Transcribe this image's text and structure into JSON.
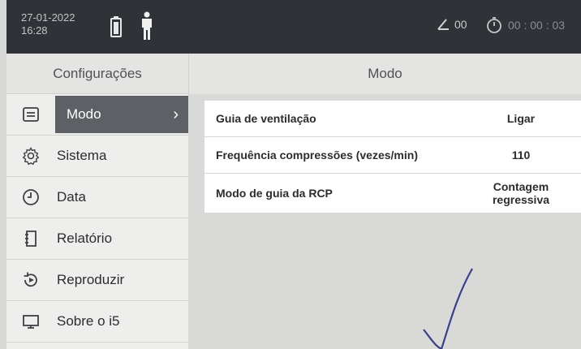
{
  "status_bar": {
    "date": "27-01-2022",
    "time": "16:28",
    "angle_value": "00",
    "timer_value": "00 : 00 : 03"
  },
  "left_panel": {
    "header": "Configurações",
    "items": [
      {
        "label": "Modo",
        "icon": "list-icon",
        "active": true
      },
      {
        "label": "Sistema",
        "icon": "gear-icon",
        "active": false
      },
      {
        "label": "Data",
        "icon": "clock-icon",
        "active": false
      },
      {
        "label": "Relatório",
        "icon": "report-icon",
        "active": false
      },
      {
        "label": "Reproduzir",
        "icon": "replay-icon",
        "active": false
      },
      {
        "label": "Sobre o i5",
        "icon": "monitor-icon",
        "active": false
      }
    ]
  },
  "right_panel": {
    "header": "Modo",
    "settings": [
      {
        "label": "Guia de ventilação",
        "value": "Ligar"
      },
      {
        "label": "Frequência compressões (vezes/min)",
        "value": "110"
      },
      {
        "label": "Modo de guia da RCP",
        "value": "Contagem regressiva"
      }
    ]
  },
  "colors": {
    "active_item_bg": "#5d6166",
    "status_bar_bg": "#2f3236",
    "panel_bg": "#eeeeec"
  }
}
